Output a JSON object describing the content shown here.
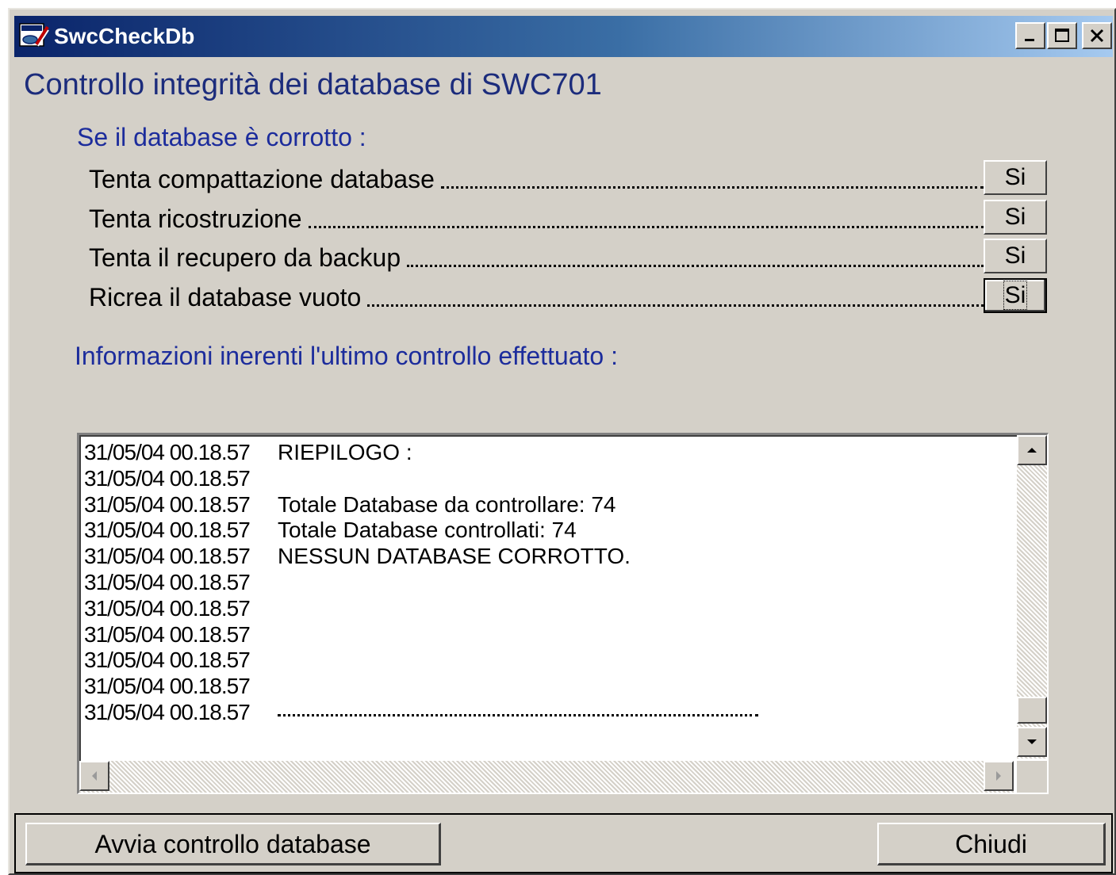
{
  "window": {
    "title": "SwcCheckDb",
    "icon": "swc-app-icon",
    "controls": [
      "minimize-icon",
      "maximize-icon",
      "close-icon"
    ]
  },
  "heading": "Controllo integrità dei database di SWC701",
  "corrupt_section": {
    "label": "Se il database è corrotto :",
    "options": [
      {
        "label": "Tenta compattazione database",
        "value": "Si"
      },
      {
        "label": "Tenta ricostruzione",
        "value": "Si"
      },
      {
        "label": "Tenta il recupero da backup",
        "value": "Si"
      },
      {
        "label": "Ricrea il database vuoto",
        "value": "Si"
      }
    ]
  },
  "info_section": {
    "label": "Informazioni inerenti l'ultimo controllo effettuato :"
  },
  "log": [
    {
      "timestamp": "31/05/04 00.18.57",
      "message": "RIEPILOGO :"
    },
    {
      "timestamp": "31/05/04 00.18.57",
      "message": ""
    },
    {
      "timestamp": "31/05/04 00.18.57",
      "message": "Totale Database da controllare: 74"
    },
    {
      "timestamp": "31/05/04 00.18.57",
      "message": "Totale Database controllati: 74"
    },
    {
      "timestamp": "31/05/04 00.18.57",
      "message": "NESSUN DATABASE CORROTTO."
    },
    {
      "timestamp": "31/05/04 00.18.57",
      "message": ""
    },
    {
      "timestamp": "31/05/04 00.18.57",
      "message": ""
    },
    {
      "timestamp": "31/05/04 00.18.57",
      "message": ""
    },
    {
      "timestamp": "31/05/04 00.18.57",
      "message": ""
    },
    {
      "timestamp": "31/05/04 00.18.57",
      "message": ""
    },
    {
      "timestamp": "31/05/04 00.18.57",
      "message": "",
      "separator": true
    }
  ],
  "buttons": {
    "start": "Avvia controllo database",
    "close": "Chiudi"
  }
}
